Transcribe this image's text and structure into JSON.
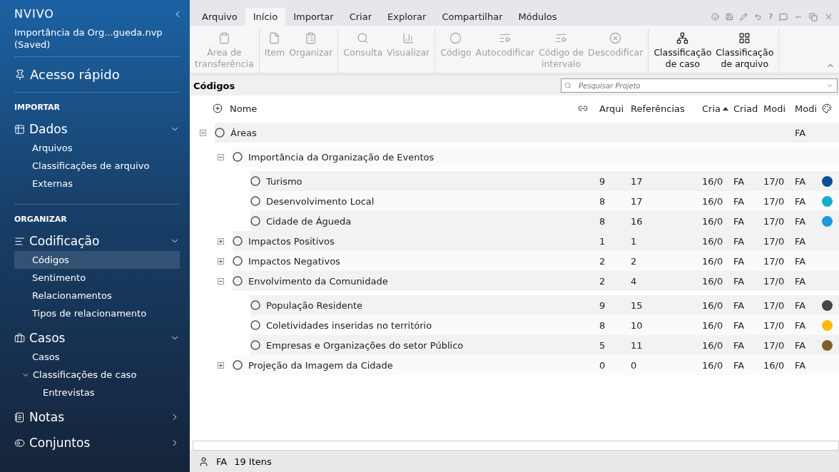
{
  "sidebar": {
    "logo": "NVIVO",
    "project": "Importância da Org...gueda.nvp",
    "status": "(Saved)",
    "quick_access": "Acesso rápido",
    "sections": [
      {
        "heading": "IMPORTAR",
        "groups": [
          {
            "label": "Dados",
            "expanded": true,
            "items": [
              {
                "label": "Arquivos",
                "selected": false
              },
              {
                "label": "Classificações de arquivo",
                "selected": false
              },
              {
                "label": "Externas",
                "selected": false
              }
            ]
          }
        ]
      },
      {
        "heading": "ORGANIZAR",
        "groups": [
          {
            "label": "Codificação",
            "expanded": true,
            "items": [
              {
                "label": "Códigos",
                "selected": true
              },
              {
                "label": "Sentimento",
                "selected": false
              },
              {
                "label": "Relacionamentos",
                "selected": false
              },
              {
                "label": "Tipos de relacionamento",
                "selected": false
              }
            ]
          },
          {
            "label": "Casos",
            "expanded": true,
            "items": [
              {
                "label": "Casos",
                "selected": false
              },
              {
                "label": "Classificações de caso",
                "selected": false,
                "expanded": true,
                "children": [
                  {
                    "label": "Entrevistas",
                    "selected": false
                  }
                ]
              }
            ]
          },
          {
            "label": "Notas",
            "expanded": false
          },
          {
            "label": "Conjuntos",
            "expanded": false
          }
        ]
      }
    ]
  },
  "tabs": [
    {
      "label": "Arquivo",
      "selected": false
    },
    {
      "label": "Início",
      "selected": true
    },
    {
      "label": "Importar",
      "selected": false
    },
    {
      "label": "Criar",
      "selected": false
    },
    {
      "label": "Explorar",
      "selected": false
    },
    {
      "label": "Compartilhar",
      "selected": false
    },
    {
      "label": "Módulos",
      "selected": false
    }
  ],
  "help": "?",
  "ribbon": [
    [
      {
        "label": "Área de\ntransferência",
        "disabled": true
      }
    ],
    [
      {
        "label": "Item",
        "disabled": true
      },
      {
        "label": "Organizar",
        "disabled": true
      }
    ],
    [
      {
        "label": "Consulta",
        "disabled": true
      },
      {
        "label": "Visualizar",
        "disabled": true
      }
    ],
    [
      {
        "label": "Código",
        "disabled": true
      },
      {
        "label": "Autocodificar",
        "disabled": true
      },
      {
        "label": "Código de\nintervalo",
        "disabled": true
      },
      {
        "label": "Descodificar",
        "disabled": true
      }
    ],
    [
      {
        "label": "Classificação\nde caso",
        "disabled": false
      },
      {
        "label": "Classificação\nde arquivo",
        "disabled": false
      }
    ]
  ],
  "panel": {
    "title": "Códigos",
    "search_placeholder": "Pesquisar Projeto"
  },
  "table": {
    "columns": [
      {
        "label": "Nome",
        "sorted": false
      },
      {
        "label": "Arqui",
        "sorted": false
      },
      {
        "label": "Referências",
        "sorted": false
      },
      {
        "label": "Cria",
        "sorted": true
      },
      {
        "label": "Criad",
        "sorted": false
      },
      {
        "label": "Modi",
        "sorted": false
      },
      {
        "label": "Modi",
        "sorted": false
      }
    ],
    "rows": [
      {
        "name": "Áreas",
        "expanded": true,
        "modified_by": "FA",
        "children": [
          {
            "name": "Importância da Organização de Eventos",
            "expanded": true,
            "children": [
              {
                "name": "Turismo",
                "files": "9",
                "refs": "17",
                "created": "16/0",
                "created_by": "FA",
                "modified": "17/0",
                "modified_by": "FA",
                "color": "#0f4c97"
              },
              {
                "name": "Desenvolvimento Local",
                "files": "8",
                "refs": "17",
                "created": "16/0",
                "created_by": "FA",
                "modified": "17/0",
                "modified_by": "FA",
                "color": "#12afc9"
              },
              {
                "name": "Cidade de Águeda",
                "files": "8",
                "refs": "16",
                "created": "16/0",
                "created_by": "FA",
                "modified": "17/0",
                "modified_by": "FA",
                "color": "#1c98dc"
              }
            ]
          },
          {
            "name": "Impactos Positivos",
            "expanded": false,
            "files": "1",
            "refs": "1",
            "created": "16/0",
            "created_by": "FA",
            "modified": "17/0",
            "modified_by": "FA"
          },
          {
            "name": "Impactos Negativos",
            "expanded": false,
            "files": "2",
            "refs": "2",
            "created": "16/0",
            "created_by": "FA",
            "modified": "17/0",
            "modified_by": "FA"
          },
          {
            "name": "Envolvimento da Comunidade",
            "expanded": true,
            "files": "2",
            "refs": "4",
            "created": "16/0",
            "created_by": "FA",
            "modified": "17/0",
            "modified_by": "FA",
            "children": [
              {
                "name": "População Residente",
                "files": "9",
                "refs": "15",
                "created": "16/0",
                "created_by": "FA",
                "modified": "17/0",
                "modified_by": "FA",
                "color": "#4a4542"
              },
              {
                "name": "Coletividades inseridas no território",
                "files": "8",
                "refs": "10",
                "created": "16/0",
                "created_by": "FA",
                "modified": "17/0",
                "modified_by": "FA",
                "color": "#fbbb0c"
              },
              {
                "name": "Empresas e Organizações do setor Público",
                "files": "5",
                "refs": "11",
                "created": "16/0",
                "created_by": "FA",
                "modified": "17/0",
                "modified_by": "FA",
                "color": "#7d5f2a"
              }
            ]
          },
          {
            "name": "Projeção da Imagem da Cidade",
            "expanded": false,
            "files": "0",
            "refs": "0",
            "created": "16/0",
            "created_by": "FA",
            "modified": "16/0",
            "modified_by": "FA"
          }
        ]
      }
    ]
  },
  "status_bar": {
    "user": "FA",
    "count": "19 Itens"
  }
}
